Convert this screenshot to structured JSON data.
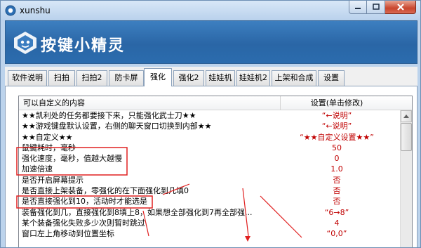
{
  "window": {
    "title": "xunshu",
    "logo_text": "按键小精灵"
  },
  "tabs": [
    {
      "label": "软件说明"
    },
    {
      "label": "扫拍"
    },
    {
      "label": "扫拍2"
    },
    {
      "label": "防卡屏"
    },
    {
      "label": "强化"
    },
    {
      "label": "强化2"
    },
    {
      "label": "娃娃机"
    },
    {
      "label": "娃娃机2"
    },
    {
      "label": "上架和合成"
    },
    {
      "label": "设置"
    }
  ],
  "active_tab": "强化",
  "table": {
    "columns": [
      "可以自定义的内容",
      "设置(单击修改)"
    ],
    "rows": [
      {
        "name": "★★凯利处的任务都要接下来，只能强化武士刀★★",
        "value": "“←说明”"
      },
      {
        "name": "★★游戏键盘默认设置，右侧的聊天窗口切换到内部★★",
        "value": "“←说明”"
      },
      {
        "name": "★★自定义★★",
        "value": "“★★自定义设置★★”"
      },
      {
        "name": "鼠键耗时，毫秒",
        "value": "50"
      },
      {
        "name": "强化速度，毫秒，值越大越慢",
        "value": "0"
      },
      {
        "name": "加速倍速",
        "value": "1.0"
      },
      {
        "name": "是否开启屏幕提示",
        "value": "否"
      },
      {
        "name": "是否直接上架装备，零强化的在下面强化到几填0",
        "value": "否"
      },
      {
        "name": "是否直接强化到10，活动时才能选是",
        "value": "否"
      },
      {
        "name": "装备强化到几，直接强化到8填上8，如果想全部强化到7再全部强...",
        "value": "“6→8”"
      },
      {
        "name": "某个装备强化失败多少次则暂时跳过",
        "value": "4"
      },
      {
        "name": "窗口左上角移动到位置坐标",
        "value": "“0,0”"
      }
    ]
  },
  "colors": {
    "value_text": "#c00000",
    "annotation_red": "#e02020",
    "banner_blue": "#2a66a6"
  }
}
